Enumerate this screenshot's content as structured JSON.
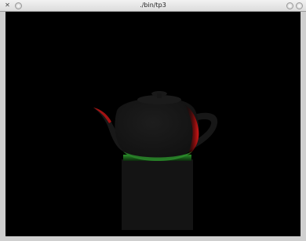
{
  "window": {
    "title": "./bin/tp3",
    "close_glyph": "✕",
    "buttons": [
      "menu-icon",
      "close-icon",
      "minimize-icon",
      "maximize-icon"
    ]
  },
  "scene": {
    "background_color": "#000000",
    "teapot_color": "#1a1a1a",
    "highlight_red": "#c81414",
    "highlight_green": "#2fa02f",
    "pedestal_color": "#141414"
  }
}
